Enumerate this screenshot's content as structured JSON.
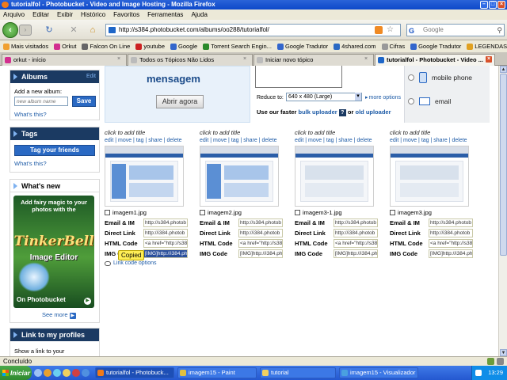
{
  "window": {
    "title": "tutorialfol - Photobucket - Video and Image Hosting - Mozilla Firefox"
  },
  "menu": [
    "Arquivo",
    "Editar",
    "Exibir",
    "Histórico",
    "Favoritos",
    "Ferramentas",
    "Ajuda"
  ],
  "nav": {
    "url": "http://s384.photobucket.com/albums/oo288/tutorialfol/",
    "search_placeholder": "Google"
  },
  "bookmarks": [
    {
      "label": "Mais visitados",
      "color": "#f0a030"
    },
    {
      "label": "Orkut",
      "color": "#d22f8f"
    },
    {
      "label": "Falcon On Line",
      "color": "#666"
    },
    {
      "label": "youtube",
      "color": "#cc2222"
    },
    {
      "label": "Google",
      "color": "#3366cc"
    },
    {
      "label": "Torrent Search Engin...",
      "color": "#2a8a2a"
    },
    {
      "label": "Google Tradutor",
      "color": "#3366cc"
    },
    {
      "label": "4shared.com",
      "color": "#2a69c3"
    },
    {
      "label": "Cifras",
      "color": "#999"
    },
    {
      "label": "Google Tradutor",
      "color": "#3366cc"
    },
    {
      "label": "LEGENDAS.TV -",
      "color": "#e0a020"
    }
  ],
  "tabs": [
    {
      "label": "orkut - início",
      "active": false
    },
    {
      "label": "Todos os Tópicos Não Lidos",
      "active": false
    },
    {
      "label": "Iniciar novo tópico",
      "active": false
    },
    {
      "label": "tutorialfol - Photobucket - Video ...",
      "active": true
    }
  ],
  "sidebar": {
    "albums": {
      "title": "Albums",
      "edit": "Edit",
      "add_label": "Add a new album:",
      "input_placeholder": "new album name",
      "save": "Save",
      "whats_this": "What's this?"
    },
    "tags": {
      "title": "Tags",
      "button": "Tag your friends",
      "whats_this": "What's this?"
    },
    "whats_new": {
      "title": "What's new",
      "promo_line1": "Add fairy magic to your photos with the",
      "promo_line2": "TinkerBell",
      "promo_line3": "Image Editor",
      "promo_line4": "On Photobucket",
      "see_more": "See more"
    },
    "link_profiles": {
      "title": "Link to my profiles",
      "text": "Show a link to your"
    }
  },
  "banner": {
    "message": "mensagem",
    "open_now": "Abrir agora",
    "reduce_to": "Reduce to:",
    "size_option": "640 x 480 (Large)",
    "more_options": "more options",
    "uploader_prefix": "Use our faster",
    "bulk_uploader": "bulk uploader",
    "q": "?",
    "or": "or",
    "old_uploader": "old uploader",
    "mobile_phone": "mobile phone",
    "email": "email"
  },
  "image_cards": [
    {
      "title": "click to add title",
      "actions": "edit | move | tag | share | delete",
      "filename": "imagem1.jpg",
      "plain_thumb": false,
      "codes": {
        "email_im": "http://s384.photob",
        "direct": "http://i384.photob",
        "html": "<a href=\"http://s38",
        "img": "[IMG]http://i384.ph"
      }
    },
    {
      "title": "click to add title",
      "actions": "edit | move | tag | share | delete",
      "filename": "imagem2.jpg",
      "plain_thumb": false,
      "codes": {
        "email_im": "http://s384.photob",
        "direct": "http://i384.photob",
        "html": "<a href=\"http://s38",
        "img": "[IMG]http://i384.ph"
      }
    },
    {
      "title": "click to add title",
      "actions": "edit | move | tag | share | delete",
      "filename": "imagem3-1.jpg",
      "plain_thumb": true,
      "codes": {
        "email_im": "http://s384.photob",
        "direct": "http://i384.photob",
        "html": "<a href=\"http://s38",
        "img": "[IMG]http://i384.ph"
      }
    },
    {
      "title": "click to add title",
      "actions": "edit | move | tag | share | delete",
      "filename": "imagem3.jpg",
      "plain_thumb": true,
      "codes": {
        "email_im": "http://s384.photob",
        "direct": "http://i384.photob",
        "html": "<a href=\"http://s38",
        "img": "[IMG]http://i384.ph"
      }
    }
  ],
  "code_labels": {
    "email_im": "Email & IM",
    "direct": "Direct Link",
    "html": "HTML Code",
    "img": "IMG Code"
  },
  "copied_tooltip": "Copied",
  "link_code_options": "Link code options",
  "status": {
    "text": "Concluído"
  },
  "taskbar": {
    "start": "Iniciar",
    "tasks": [
      {
        "label": "tutorialfol - Photobuck...",
        "active": true,
        "color": "#f07a1a"
      },
      {
        "label": "imagem15 - Paint",
        "active": false,
        "color": "#e0c040"
      },
      {
        "label": "tutorial",
        "active": false,
        "color": "#f0d060"
      },
      {
        "label": "imagem15 - Visualizador ...",
        "active": false,
        "color": "#4aa0e0"
      }
    ],
    "clock": "13:29"
  }
}
